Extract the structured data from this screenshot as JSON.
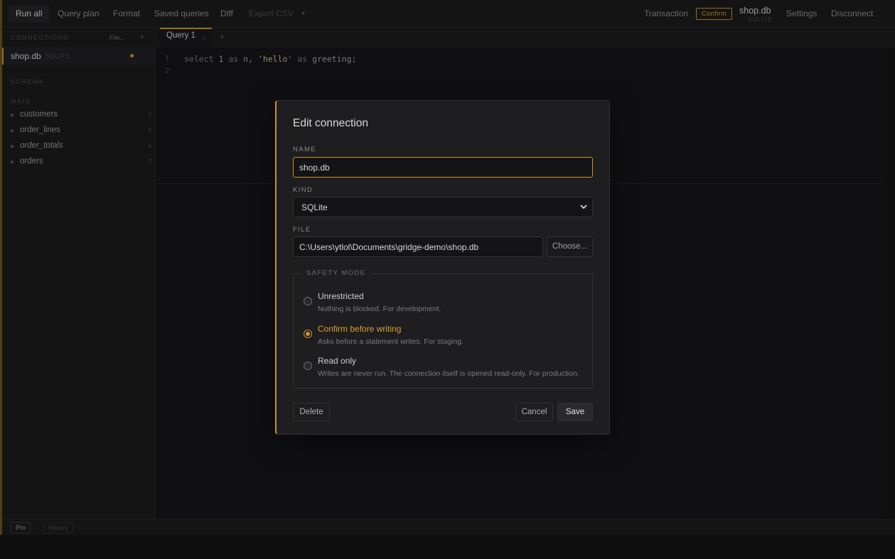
{
  "toolbar": {
    "run_all": "Run all",
    "query_plan": "Query plan",
    "format": "Format",
    "saved_queries": "Saved queries",
    "diff": "Diff",
    "export_csv": "Export CSV",
    "transaction": "Transaction",
    "mode_badge": "Confirm",
    "connection_name": "shop.db",
    "connection_kind": "SQLITE",
    "settings": "Settings",
    "disconnect": "Disconnect"
  },
  "sidebar": {
    "connections_heading": "CONNECTIONS",
    "file_link": "File...",
    "add_symbol": "+",
    "connection": {
      "name": "shop.db",
      "kind": "SQLITE"
    },
    "schema_heading": "SCHEMA",
    "schema_group": "MAIN",
    "tables": [
      {
        "name": "customers",
        "count": "7",
        "italic": false
      },
      {
        "name": "order_lines",
        "count": "5",
        "italic": false
      },
      {
        "name": "order_totals",
        "count": "4",
        "italic": true
      },
      {
        "name": "orders",
        "count": "7",
        "italic": false
      }
    ]
  },
  "tabs": [
    {
      "label": "Query 1",
      "close": "×"
    }
  ],
  "tab_add": "+",
  "editor": {
    "line_numbers": [
      "1",
      "2"
    ],
    "code": {
      "kw_select": "select",
      "n1": " 1 ",
      "kw_as1": "as",
      "rest1": " n, ",
      "str": "'hello'",
      "sp": " ",
      "kw_as2": "as",
      "rest2": " greeting;"
    }
  },
  "status": {
    "pro": "Pro",
    "history": "History"
  },
  "modal": {
    "title": "Edit connection",
    "name_label": "NAME",
    "name_value": "shop.db",
    "kind_label": "KIND",
    "kind_value": "SQLite",
    "file_label": "FILE",
    "file_value": "C:\\Users\\ytlol\\Documents\\gridge-demo\\shop.db",
    "choose_label": "Choose...",
    "safety_legend": "SAFETY MODE",
    "options": [
      {
        "title": "Unrestricted",
        "desc": "Nothing is blocked. For development.",
        "checked": false
      },
      {
        "title": "Confirm before writing",
        "desc": "Asks before a statement writes. For staging.",
        "checked": true
      },
      {
        "title": "Read only",
        "desc": "Writes are never run. The connection itself is opened read-only. For production.",
        "checked": false
      }
    ],
    "delete_label": "Delete",
    "cancel_label": "Cancel",
    "save_label": "Save"
  },
  "colors": {
    "accent": "#c8922a",
    "background": "#161618",
    "panel": "#1b1b1d",
    "modal": "#1e1e20"
  }
}
